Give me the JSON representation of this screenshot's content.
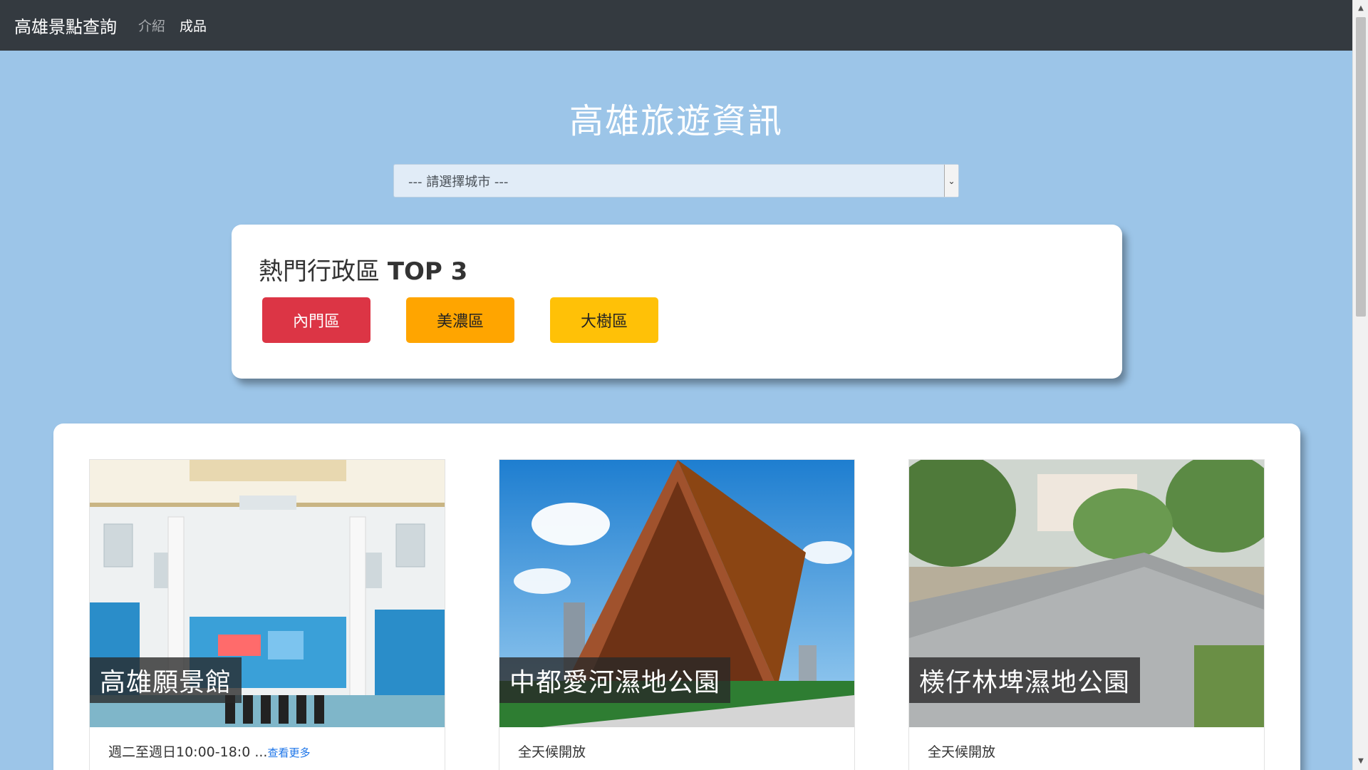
{
  "navbar": {
    "brand": "高雄景點查詢",
    "links": [
      "介紹",
      "成品"
    ]
  },
  "hero": {
    "title": "高雄旅遊資訊"
  },
  "city_select": {
    "selected": "--- 請選擇城市 ---"
  },
  "top3": {
    "title_prefix": "熱門行政區 ",
    "title_strong": "TOP 3",
    "districts": [
      "內門區",
      "美濃區",
      "大樹區"
    ]
  },
  "spots": [
    {
      "name": "高雄願景館",
      "hours": "週二至週日10:00-18:0 ...",
      "more": "查看更多",
      "image_icon": "hall-photo"
    },
    {
      "name": "中都愛河濕地公園",
      "hours": "全天候開放",
      "more": "",
      "image_icon": "wooden-pavilion-photo"
    },
    {
      "name": "檨仔林埤濕地公園",
      "hours": "全天候開放",
      "more": "",
      "image_icon": "stone-sign-photo"
    }
  ],
  "colors": {
    "navbar": "#343a40",
    "background": "#9cc5e8",
    "district_1": "#dc3545",
    "district_2": "#ffa500",
    "district_3": "#ffc107",
    "link": "#1a73e8"
  }
}
